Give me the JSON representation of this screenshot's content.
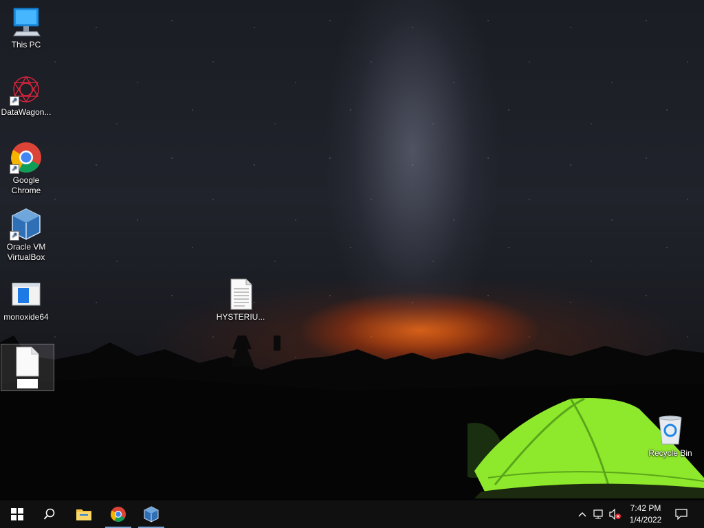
{
  "desktop": {
    "icons": [
      {
        "label": "This PC",
        "icon": "computer-icon"
      },
      {
        "label": "DataWagon...",
        "icon": "datawagon-icon"
      },
      {
        "label": "Google Chrome",
        "icon": "chrome-icon"
      },
      {
        "label": "Oracle VM VirtualBox",
        "icon": "virtualbox-icon"
      },
      {
        "label": "monoxide64",
        "icon": "window-app-icon"
      },
      {
        "label": "HYSTERIU...",
        "icon": "text-document-icon"
      },
      {
        "label": "",
        "icon": "blank-document-icon"
      },
      {
        "label": "Recycle Bin",
        "icon": "recycle-bin-icon"
      }
    ]
  },
  "taskbar": {
    "pinned": [
      {
        "name": "start-button",
        "icon": "windows-logo-icon"
      },
      {
        "name": "search-button",
        "icon": "search-icon"
      },
      {
        "name": "file-explorer",
        "icon": "folder-icon"
      },
      {
        "name": "chrome",
        "icon": "chrome-icon",
        "active": true
      },
      {
        "name": "virtualbox",
        "icon": "virtualbox-icon",
        "active": true
      }
    ],
    "tray": {
      "time": "7:42 PM",
      "date": "1/4/2022"
    }
  },
  "colors": {
    "taskbar_bg": "#101010",
    "active_indicator": "#7aa6d6",
    "tent_green": "#8ee82b",
    "sunset_orange": "#ff6e14"
  }
}
